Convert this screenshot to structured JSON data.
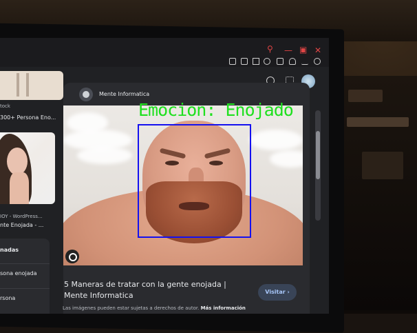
{
  "detection": {
    "label": "Emocion: Enojado",
    "box_color": "#1410f0",
    "label_color": "#1fe01f"
  },
  "browser": {
    "toolbar_icons": [
      "edit-icon",
      "camera-icon",
      "send-icon",
      "heart-icon",
      "box-icon",
      "bell-icon",
      "menu-icon",
      "profile-icon"
    ],
    "window_controls": [
      "search-icon",
      "minimize-icon",
      "restore-icon",
      "close-icon"
    ],
    "window_control_color": "#e04545"
  },
  "left_results": {
    "item1": {
      "source": "tock",
      "title": "300+ Persona Eno..."
    },
    "item2": {
      "source": "IOY - WordPress...",
      "title": "nte Enojada - ..."
    },
    "panel": {
      "heading": "nadas",
      "items": [
        "sona enojada",
        "rsona"
      ]
    }
  },
  "preview": {
    "source_name": "Mente Informatica",
    "caption": "5 Maneras de tratar con la gente enojada | Mente Informatica",
    "visit_label": "Visitar",
    "disclaimer": "Las imágenes pueden estar sujetas a derechos de autor.",
    "disclaimer_link": "Más información"
  }
}
